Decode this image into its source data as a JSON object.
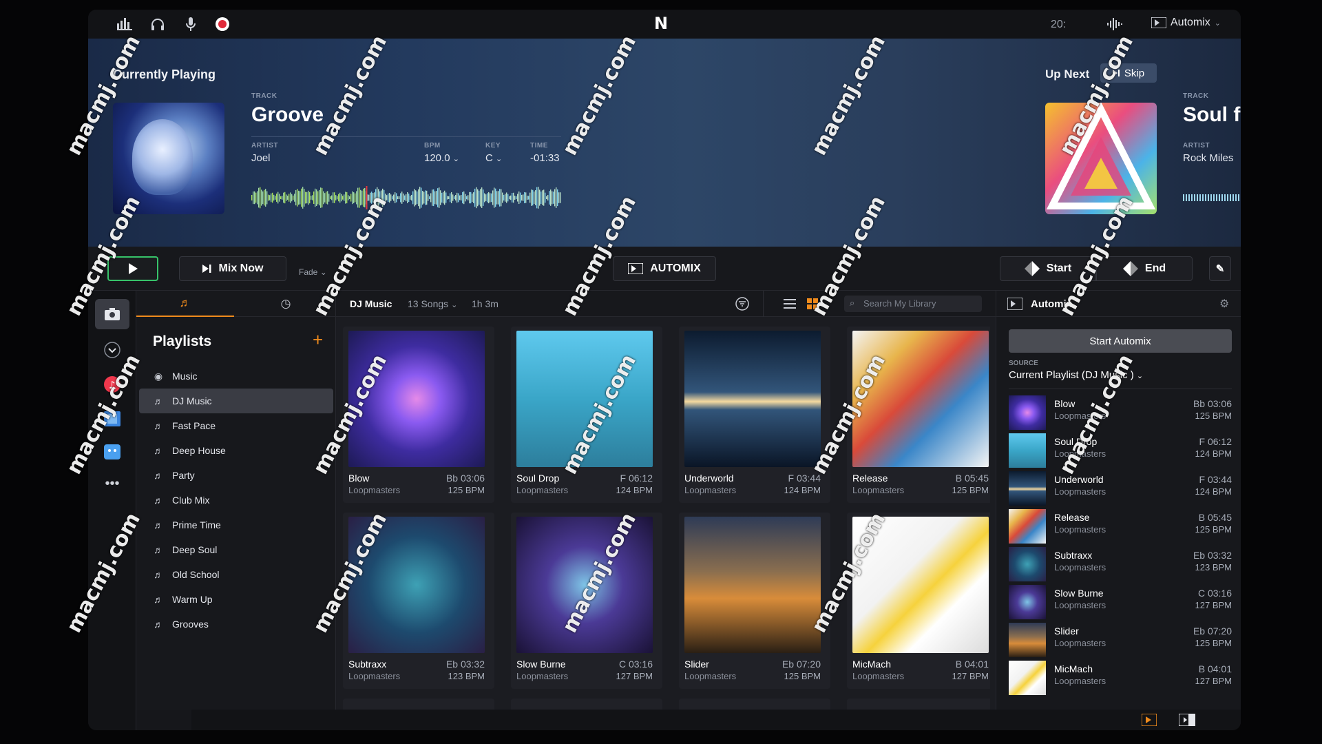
{
  "topbar": {
    "logo": "N",
    "clock": "20:",
    "automix_label": "Automix"
  },
  "now_playing": {
    "header": "Currently Playing",
    "track_label": "TRACK",
    "track": "Groove",
    "artist_label": "ARTIST",
    "artist": "Joel",
    "bpm_label": "BPM",
    "bpm": "120.0",
    "key_label": "KEY",
    "key": "C",
    "time_label": "TIME",
    "time": "-01:33",
    "playhead_fraction": 0.37
  },
  "up_next": {
    "header": "Up Next",
    "skip_label": "Skip",
    "track_label": "TRACK",
    "track": "Soul fo",
    "artist_label": "ARTIST",
    "artist": "Rock Miles"
  },
  "transport": {
    "mix_now_label": "Mix Now",
    "fade_label": "Fade",
    "automix_label": "AUTOMIX",
    "start_label": "Start",
    "end_label": "End"
  },
  "playlists": {
    "header": "Playlists",
    "items": [
      {
        "label": "Music",
        "icon": "music-circle-icon",
        "selected": false
      },
      {
        "label": "DJ Music",
        "icon": "playlist-icon",
        "selected": true
      },
      {
        "label": "Fast Pace",
        "icon": "playlist-icon",
        "selected": false
      },
      {
        "label": "Deep House",
        "icon": "playlist-icon",
        "selected": false
      },
      {
        "label": "Party",
        "icon": "playlist-icon",
        "selected": false
      },
      {
        "label": "Club Mix",
        "icon": "playlist-icon",
        "selected": false
      },
      {
        "label": "Prime Time",
        "icon": "playlist-icon",
        "selected": false
      },
      {
        "label": "Deep Soul",
        "icon": "playlist-icon",
        "selected": false
      },
      {
        "label": "Old School",
        "icon": "playlist-icon",
        "selected": false
      },
      {
        "label": "Warm Up",
        "icon": "playlist-icon",
        "selected": false
      },
      {
        "label": "Grooves",
        "icon": "playlist-icon",
        "selected": false
      }
    ]
  },
  "library": {
    "title": "DJ Music",
    "count": "13 Songs",
    "duration": "1h 3m",
    "search_placeholder": "Search My Library",
    "songs": [
      {
        "title": "Blow",
        "key": "Bb 03:06",
        "artist": "Loopmasters",
        "bpm": "125 BPM",
        "color": "#7a4fd8"
      },
      {
        "title": "Soul Drop",
        "key": "F 06:12",
        "artist": "Loopmasters",
        "bpm": "124 BPM",
        "color": "#49b8dd"
      },
      {
        "title": "Underworld",
        "key": "F 03:44",
        "artist": "Loopmasters",
        "bpm": "124 BPM",
        "color": "#3a5a7a"
      },
      {
        "title": "Release",
        "key": "B 05:45",
        "artist": "Loopmasters",
        "bpm": "125 BPM",
        "color": "#d9673a"
      },
      {
        "title": "Subtraxx",
        "key": "Eb 03:32",
        "artist": "Loopmasters",
        "bpm": "123 BPM",
        "color": "#2c6f8f"
      },
      {
        "title": "Slow Burne",
        "key": "C 03:16",
        "artist": "Loopmasters",
        "bpm": "127 BPM",
        "color": "#5b3a9e"
      },
      {
        "title": "Slider",
        "key": "Eb 07:20",
        "artist": "Loopmasters",
        "bpm": "125 BPM",
        "color": "#c8823a"
      },
      {
        "title": "MicMach",
        "key": "B 04:01",
        "artist": "Loopmasters",
        "bpm": "127 BPM",
        "color": "#e8e8e8"
      }
    ]
  },
  "automix": {
    "title": "Automix",
    "start_label": "Start Automix",
    "source_label": "SOURCE",
    "source_value": "Current Playlist (DJ Music )",
    "queue": [
      {
        "title": "Blow",
        "artist": "Loopmasters",
        "key": "Bb 03:06",
        "bpm": "125 BPM"
      },
      {
        "title": "Soul Drop",
        "artist": "Loopmasters",
        "key": "F 06:12",
        "bpm": "124 BPM"
      },
      {
        "title": "Underworld",
        "artist": "Loopmasters",
        "key": "F 03:44",
        "bpm": "124 BPM"
      },
      {
        "title": "Release",
        "artist": "Loopmasters",
        "key": "B 05:45",
        "bpm": "125 BPM"
      },
      {
        "title": "Subtraxx",
        "artist": "Loopmasters",
        "key": "Eb 03:32",
        "bpm": "123 BPM"
      },
      {
        "title": "Slow Burne",
        "artist": "Loopmasters",
        "key": "C 03:16",
        "bpm": "127 BPM"
      },
      {
        "title": "Slider",
        "artist": "Loopmasters",
        "key": "Eb 07:20",
        "bpm": "125 BPM"
      },
      {
        "title": "MicMach",
        "artist": "Loopmasters",
        "key": "B 04:01",
        "bpm": "127 BPM"
      }
    ]
  },
  "watermark": "macmj.com",
  "colors": {
    "accent": "#f08b1c",
    "play_green": "#37c36a"
  }
}
